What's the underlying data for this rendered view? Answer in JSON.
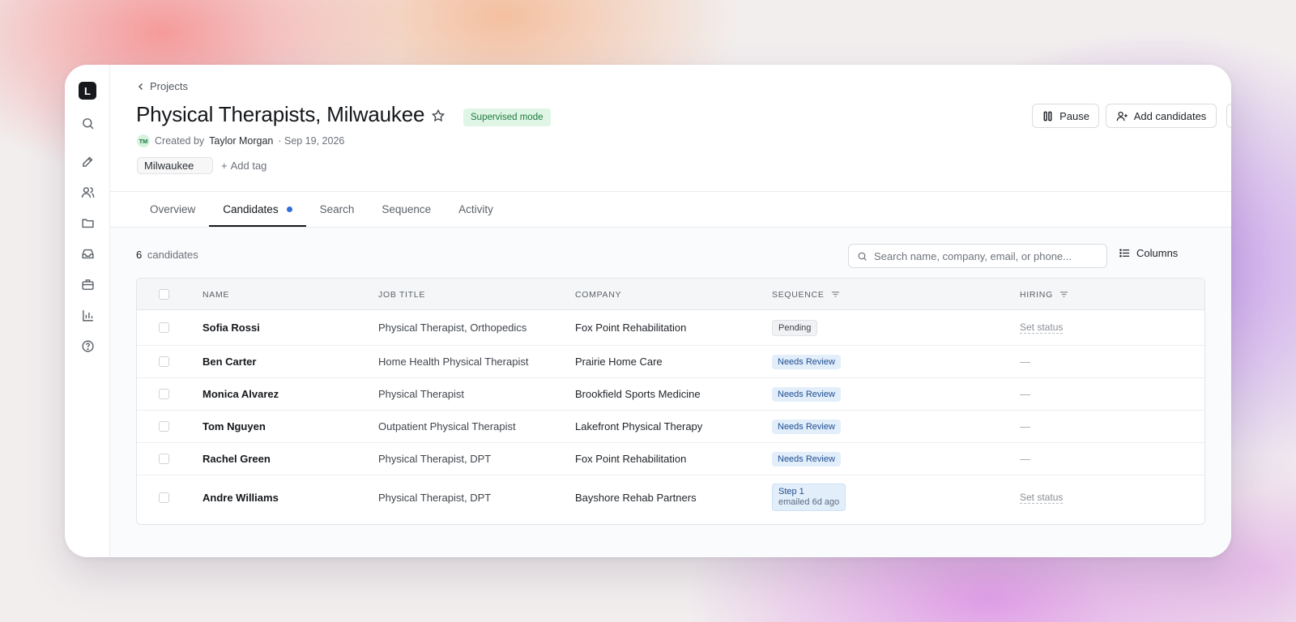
{
  "sidebar": {
    "logo": "L",
    "icons": [
      "search-icon",
      "edit-icon",
      "users-icon",
      "folder-icon",
      "inbox-icon",
      "briefcase-icon",
      "chart-icon",
      "help-icon"
    ]
  },
  "breadcrumb": {
    "label": "Projects"
  },
  "project": {
    "title": "Physical Therapists, Milwaukee",
    "mode_badge": "Supervised mode",
    "creator_initials": "TM",
    "created_by_label": "Created by",
    "creator_name": "Taylor Morgan",
    "created_date": "· Sep 19, 2026",
    "tag": "Milwaukee",
    "add_tag_label": "Add tag"
  },
  "actions": {
    "pause_label": "Pause",
    "add_candidates_label": "Add candidates",
    "more_label": "···"
  },
  "tabs": [
    {
      "label": "Overview"
    },
    {
      "label": "Candidates"
    },
    {
      "label": "Search"
    },
    {
      "label": "Sequence"
    },
    {
      "label": "Activity"
    }
  ],
  "candidates": {
    "count": "6",
    "count_label": "candidates",
    "search_placeholder": "Search name, company, email, or phone...",
    "columns_label": "Columns",
    "headers": {
      "name": "NAME",
      "job_title": "JOB TITLE",
      "company": "COMPANY",
      "sequence": "SEQUENCE",
      "hiring": "HIRING"
    },
    "rows": [
      {
        "name": "Sofia Rossi",
        "job_title": "Physical Therapist, Orthopedics",
        "company": "Fox Point Rehabilitation",
        "sequence": "Pending",
        "sequence_sub": "",
        "hiring": "Set status"
      },
      {
        "name": "Ben Carter",
        "job_title": "Home Health Physical Therapist",
        "company": "Prairie Home Care",
        "sequence": "Needs Review",
        "sequence_sub": "",
        "hiring": "—"
      },
      {
        "name": "Monica Alvarez",
        "job_title": "Physical Therapist",
        "company": "Brookfield Sports Medicine",
        "sequence": "Needs Review",
        "sequence_sub": "",
        "hiring": "—"
      },
      {
        "name": "Tom Nguyen",
        "job_title": "Outpatient Physical Therapist",
        "company": "Lakefront Physical Therapy",
        "sequence": "Needs Review",
        "sequence_sub": "",
        "hiring": "—"
      },
      {
        "name": "Rachel Green",
        "job_title": "Physical Therapist, DPT",
        "company": "Fox Point Rehabilitation",
        "sequence": "Needs Review",
        "sequence_sub": "",
        "hiring": "—"
      },
      {
        "name": "Andre Williams",
        "job_title": "Physical Therapist, DPT",
        "company": "Bayshore Rehab Partners",
        "sequence": "Step 1",
        "sequence_sub": "emailed 6d ago",
        "hiring": "Set status"
      }
    ]
  }
}
